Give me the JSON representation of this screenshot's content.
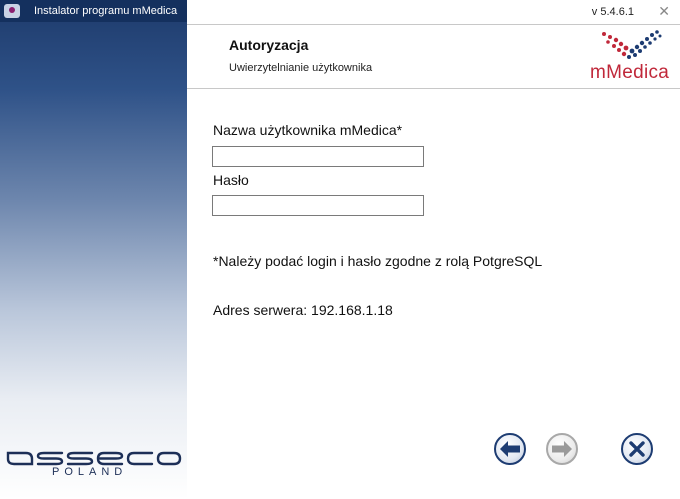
{
  "window": {
    "title": "Instalator programu mMedica",
    "version": "v 5.4.6.1",
    "close_glyph": "✕"
  },
  "header": {
    "title": "Autoryzacja",
    "subtitle": "Uwierzytelnianie użytkownika",
    "logo_text": "mMedica"
  },
  "form": {
    "username_label": "Nazwa użytkownika mMedica*",
    "username_value": "",
    "password_label": "Hasło",
    "password_value": ""
  },
  "note": "*Należy podać login i hasło zgodne z rolą PotgreSQL",
  "server": "Adres serwera: 192.168.1.18",
  "branding": {
    "company": "asseco",
    "country": "POLAND"
  },
  "buttons": {
    "back_icon": "arrow-left-icon",
    "next_icon": "arrow-right-icon",
    "cancel_icon": "close-icon"
  },
  "colors": {
    "accent_dark_blue": "#1d3c72",
    "mmedica_red": "#c0283a",
    "disabled_gray": "#a8a8a8"
  }
}
